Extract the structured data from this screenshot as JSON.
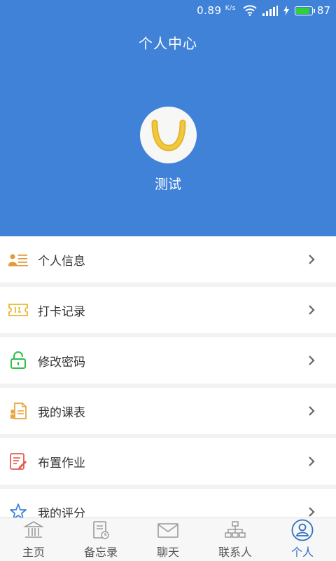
{
  "status_bar": {
    "speed_value": "0.89",
    "speed_unit": "K/s",
    "battery_level": "87",
    "battery_fraction": 0.87
  },
  "header": {
    "title": "个人中心",
    "username": "测试"
  },
  "menu": {
    "items": [
      {
        "label": "个人信息",
        "icon": "id-card-icon"
      },
      {
        "label": "打卡记录",
        "icon": "ticket-icon"
      },
      {
        "label": "修改密码",
        "icon": "lock-icon"
      },
      {
        "label": "我的课表",
        "icon": "schedule-icon"
      },
      {
        "label": "布置作业",
        "icon": "edit-note-icon"
      },
      {
        "label": "我的评分",
        "icon": "star-icon"
      }
    ]
  },
  "tabbar": {
    "tabs": [
      {
        "label": "主页",
        "icon": "bank-icon"
      },
      {
        "label": "备忘录",
        "icon": "memo-icon"
      },
      {
        "label": "聊天",
        "icon": "mail-icon"
      },
      {
        "label": "联系人",
        "icon": "org-chart-icon"
      },
      {
        "label": "个人",
        "icon": "user-icon",
        "active": true
      }
    ]
  },
  "colors": {
    "header_bg": "#3f82d8",
    "active_tab": "#2f6fbf",
    "battery_fill": "#30d03a"
  }
}
